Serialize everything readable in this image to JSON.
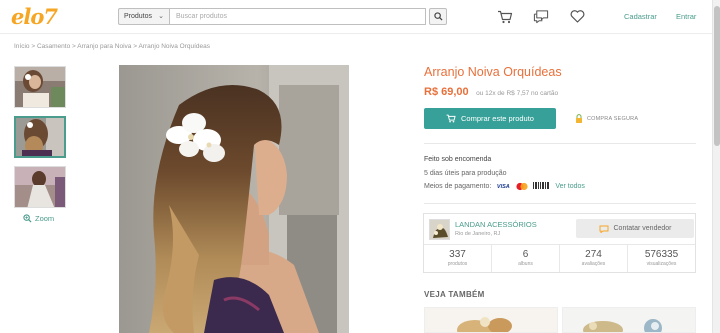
{
  "header": {
    "logo": "elo7",
    "category_select": "Produtos",
    "search_placeholder": "Buscar produtos",
    "signup": "Cadastrar",
    "login": "Entrar"
  },
  "breadcrumb": "Início > Casamento > Arranjo para Noiva > Arranjo Noiva Orquídeas",
  "gallery": {
    "zoom_label": "Zoom"
  },
  "product": {
    "title": "Arranjo Noiva Orquídeas",
    "price": "R$ 69,00",
    "installments": "ou 12x de R$ 7,57 no cartão",
    "buy_label": "Comprar este produto",
    "secure_label": "COMPRA SEGURA",
    "made_to_order": "Feito sob encomenda",
    "production_time": "5 dias úteis para produção",
    "payment_label": "Meios de pagamento:",
    "payment_methods": [
      "VISA",
      "mastercard",
      "boleto"
    ],
    "see_all": "Ver todos"
  },
  "seller": {
    "name": "LANDAN ACESSÓRIOS",
    "location": "Rio de Janeiro, RJ",
    "contact_label": "Contatar vendedor",
    "stats": [
      {
        "value": "337",
        "label": "produtos"
      },
      {
        "value": "6",
        "label": "albuns"
      },
      {
        "value": "274",
        "label": "avaliações"
      },
      {
        "value": "576335",
        "label": "visualizações"
      }
    ]
  },
  "related": {
    "title": "VEJA TAMBÉM"
  },
  "colors": {
    "accent_orange": "#e8703b",
    "teal": "#37a199",
    "logo_yellow": "#f6a623"
  }
}
